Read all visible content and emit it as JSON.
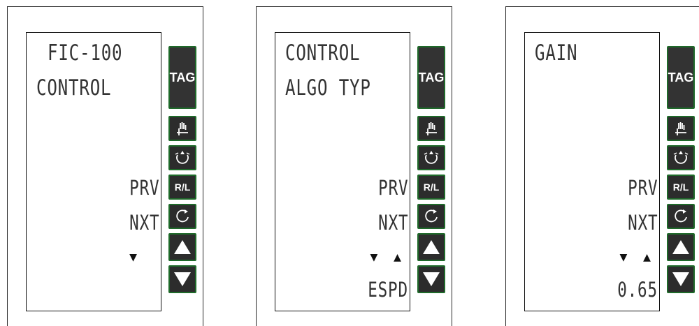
{
  "panels": [
    {
      "lines": [
        "FIC-100",
        "CONTROL"
      ],
      "prev": "PRV",
      "next": "NXT",
      "arrows": "▼",
      "value": ""
    },
    {
      "lines": [
        "CONTROL",
        "ALGO TYP"
      ],
      "prev": "PRV",
      "next": "NXT",
      "arrows": "▼ ▲",
      "value": "ESPD"
    },
    {
      "lines": [
        "GAIN",
        ""
      ],
      "prev": "PRV",
      "next": "NXT",
      "arrows": "▼ ▲",
      "value": "0.65"
    }
  ],
  "buttons": {
    "tag": "TAG",
    "rl": "R/L"
  },
  "colors": {
    "button_bg": "#2c2c2c",
    "button_border": "#1f6a2a",
    "lcd_text": "#333333"
  }
}
